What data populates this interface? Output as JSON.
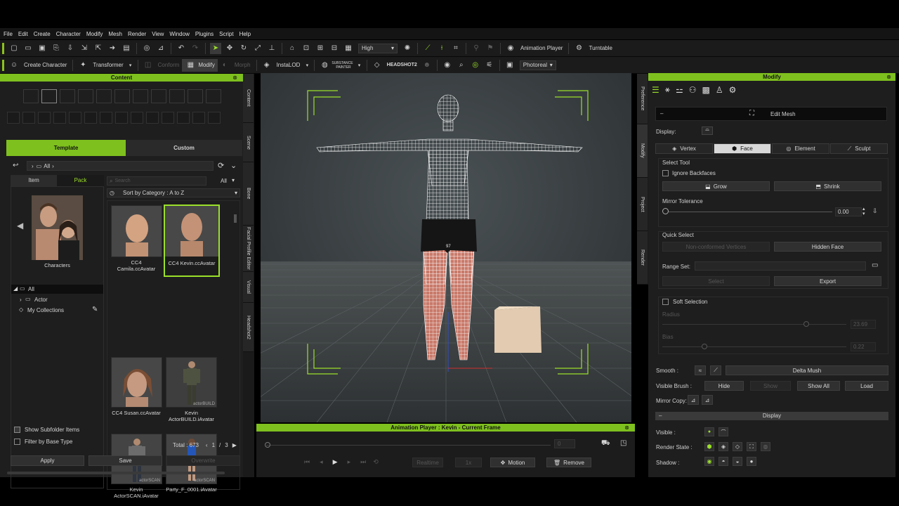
{
  "menu": [
    "File",
    "Edit",
    "Create",
    "Character",
    "Modify",
    "Mesh",
    "Render",
    "View",
    "Window",
    "Plugins",
    "Script",
    "Help"
  ],
  "toolbar1": {
    "quality": "High",
    "animation_player": "Animation Player",
    "turntable": "Turntable"
  },
  "toolbar2": {
    "create_character": "Create Character",
    "transformer": "Transformer",
    "conform": "Conform",
    "modify": "Modify",
    "morph": "Morph",
    "instalod": "InstaLOD",
    "substance_line1": "SUBSTANCE",
    "substance_line2": "PAINTER",
    "headshot": "HEADSHOT2",
    "render_mode": "Photoreal"
  },
  "content": {
    "title": "Content",
    "tab_template": "Template",
    "tab_custom": "Custom",
    "path": "All",
    "subtab_item": "Item",
    "subtab_pack": "Pack",
    "search_placeholder": "Search",
    "filter": "All",
    "sort": "Sort by Category : A to Z",
    "pack_name": "Characters",
    "tree": {
      "all": "All",
      "actor": "Actor",
      "collections": "My Collections"
    },
    "items": [
      {
        "name_line1": "CC4",
        "name_line2": "Camila.ccAvatar"
      },
      {
        "name_line1": "CC4 Kevin.ccAvatar",
        "name_line2": ""
      },
      {
        "name_line1": "CC4 Susan.ccAvatar",
        "name_line2": ""
      },
      {
        "name_line1": "Kevin",
        "name_line2": "ActorBUILD.iAvatar",
        "watermark": "actorBUILD"
      },
      {
        "name_line1": "Kevin",
        "name_line2": "ActorSCAN.iAvatar",
        "watermark": "actorSCAN"
      },
      {
        "name_line1": "Party_F_0001.iAvatar",
        "name_line2": "",
        "watermark": "actorSCAN"
      }
    ],
    "show_subfolder": "Show Subfolder Items",
    "filter_base": "Filter by Base Type",
    "total": "Total : 673",
    "page": "1",
    "page_sep": "/",
    "page_total": "3",
    "apply": "Apply",
    "save": "Save",
    "overwrite": "Overwrite"
  },
  "side_tabs": [
    "Content",
    "Scene",
    "Bone",
    "Facial Profile Editor",
    "Visual",
    "Headshot2"
  ],
  "right_tabs": [
    "Preference",
    "Modify",
    "Project",
    "Render"
  ],
  "viewport": {
    "label": "97"
  },
  "animation_player": {
    "title": "Animation Player : Kevin - Current Frame",
    "frame": "0",
    "realtime": "Realtime",
    "speed": "1x",
    "motion": "Motion",
    "remove": "Remove"
  },
  "modify": {
    "title": "Modify",
    "edit_mesh": "Edit Mesh",
    "display_label": "Display:",
    "modes": [
      "Vertex",
      "Face",
      "Element",
      "Sculpt"
    ],
    "active_mode": "Face",
    "select_tool": "Select Tool",
    "ignore_backfaces": "Ignore Backfaces",
    "grow": "Grow",
    "shrink": "Shrink",
    "mirror_tolerance": "Mirror Tolerance",
    "mirror_value": "0.00",
    "quick_select": "Quick Select",
    "non_conformed": "Non-conformed Vertices",
    "hidden_face": "Hidden Face",
    "range_set": "Range Set:",
    "select": "Select",
    "export": "Export",
    "soft_selection": "Soft Selection",
    "radius": "Radius",
    "radius_value": "23.69",
    "bias": "Bias",
    "bias_value": "0.22",
    "smooth": "Smooth :",
    "delta_mush": "Delta Mush",
    "visible_brush": "Visible Brush :",
    "hide": "Hide",
    "show": "Show",
    "show_all": "Show All",
    "load": "Load",
    "mirror_copy": "Mirror Copy:",
    "display_section": "Display",
    "visible": "Visible :",
    "render_state": "Render State :",
    "shadow": "Shadow :"
  },
  "colors": {
    "accent": "#7ec01e",
    "panel": "#1e1e1e",
    "viewport": "#3a3f41"
  }
}
